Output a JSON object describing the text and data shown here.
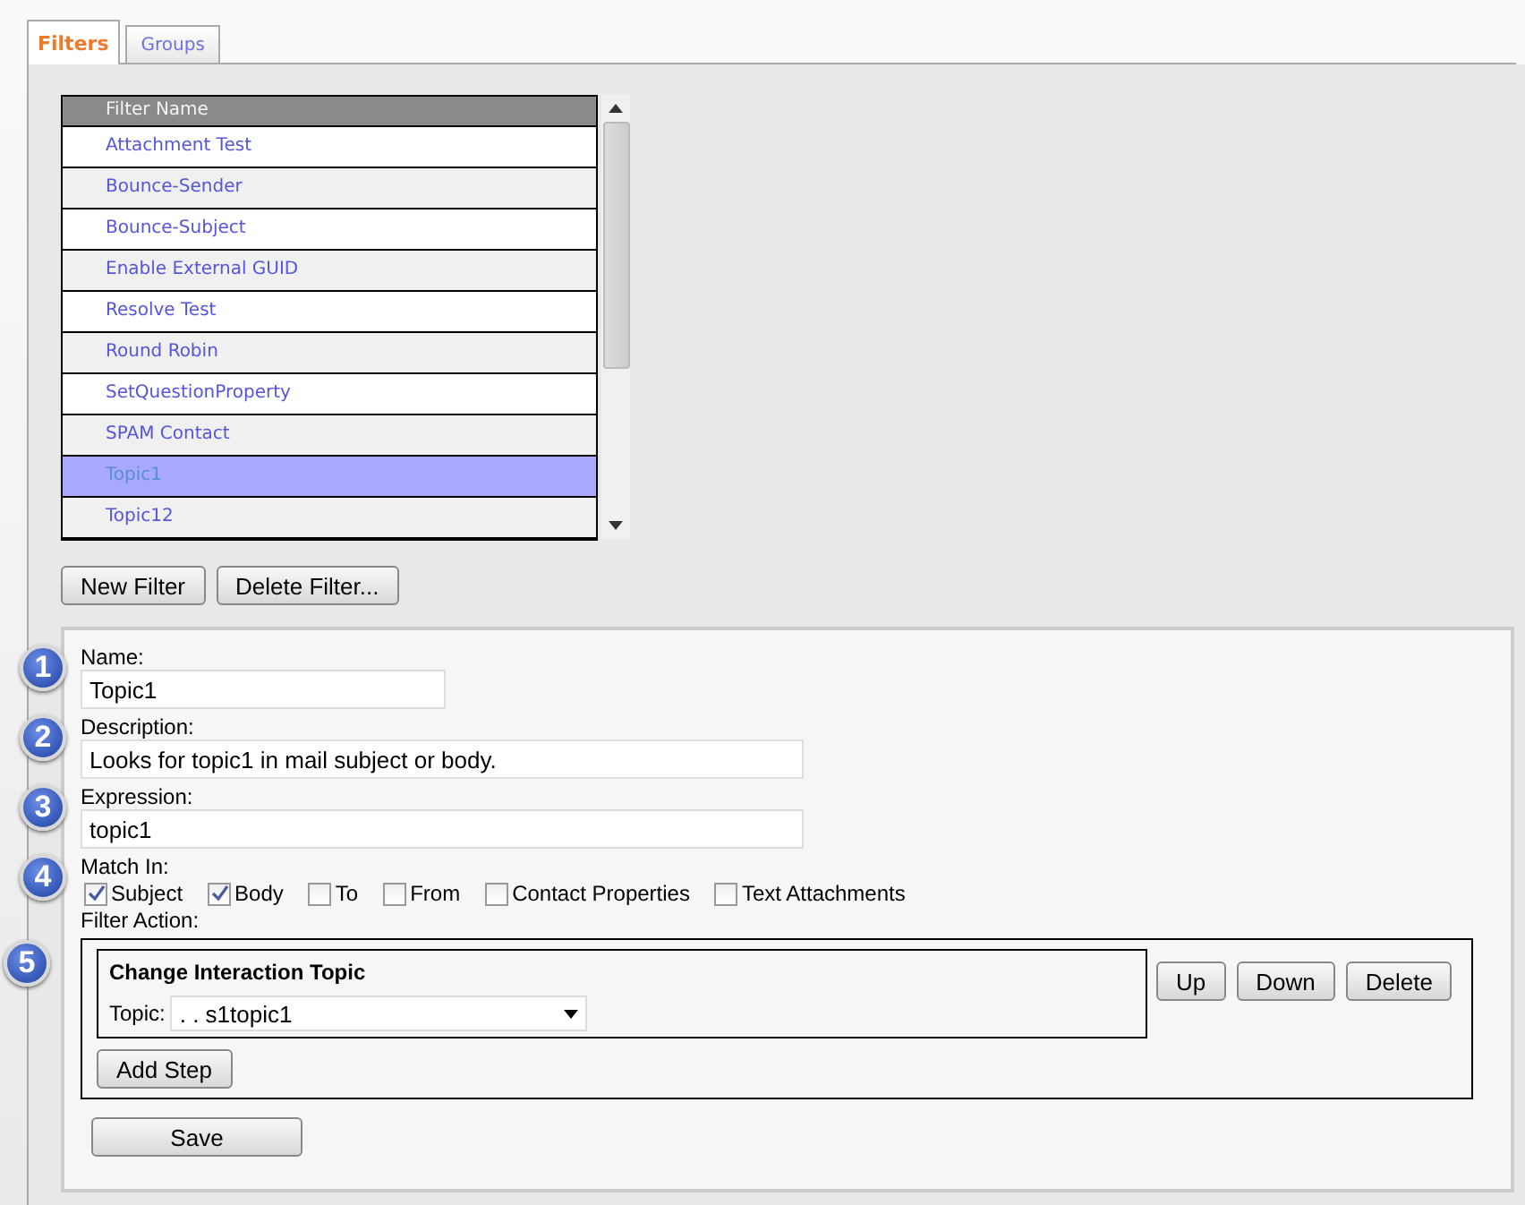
{
  "tabs": [
    {
      "label": "Filters",
      "selected": true
    },
    {
      "label": "Groups",
      "selected": false
    }
  ],
  "filter_list": {
    "column": "Filter Name",
    "rows": [
      {
        "name": "Attachment Test",
        "selected": false
      },
      {
        "name": "Bounce-Sender",
        "selected": false
      },
      {
        "name": "Bounce-Subject",
        "selected": false
      },
      {
        "name": "Enable External GUID",
        "selected": false
      },
      {
        "name": "Resolve Test",
        "selected": false
      },
      {
        "name": "Round Robin",
        "selected": false
      },
      {
        "name": "SetQuestionProperty",
        "selected": false
      },
      {
        "name": "SPAM Contact",
        "selected": false
      },
      {
        "name": "Topic1",
        "selected": true
      },
      {
        "name": "Topic12",
        "selected": false
      }
    ]
  },
  "list_buttons": [
    "New Filter",
    "Delete Filter..."
  ],
  "form": {
    "name": {
      "badge": "1",
      "label": "Name:",
      "value": "Topic1"
    },
    "description": {
      "badge": "2",
      "label": "Description:",
      "value": "Looks for topic1 in mail subject or body."
    },
    "expression": {
      "badge": "3",
      "label": "Expression:",
      "value": "topic1"
    },
    "match_in": {
      "badge": "4",
      "label": "Match In:",
      "options": [
        {
          "label": "Subject",
          "checked": true
        },
        {
          "label": "Body",
          "checked": true
        },
        {
          "label": "To",
          "checked": false
        },
        {
          "label": "From",
          "checked": false
        },
        {
          "label": "Contact Properties",
          "checked": false
        },
        {
          "label": "Text Attachments",
          "checked": false
        }
      ]
    },
    "filter_action": {
      "badge": "5",
      "label": "Filter Action:",
      "step_title": "Change Interaction Topic",
      "topic_label": "Topic:",
      "topic_value": ". . s1topic1",
      "step_buttons": [
        "Up",
        "Down",
        "Delete"
      ],
      "add_step": "Add Step"
    },
    "save": "Save"
  }
}
